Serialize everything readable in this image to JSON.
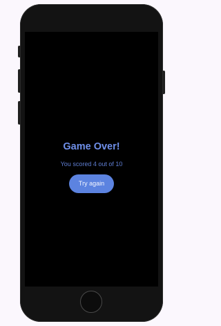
{
  "game_over": {
    "title": "Game Over!",
    "score_text": "You scored 4 out of 10",
    "try_again_label": "Try again"
  },
  "colors": {
    "accent": "#5c83e0",
    "title": "#6f8fe9",
    "screen_background": "#000000",
    "page_background": "#fbf7fd"
  }
}
